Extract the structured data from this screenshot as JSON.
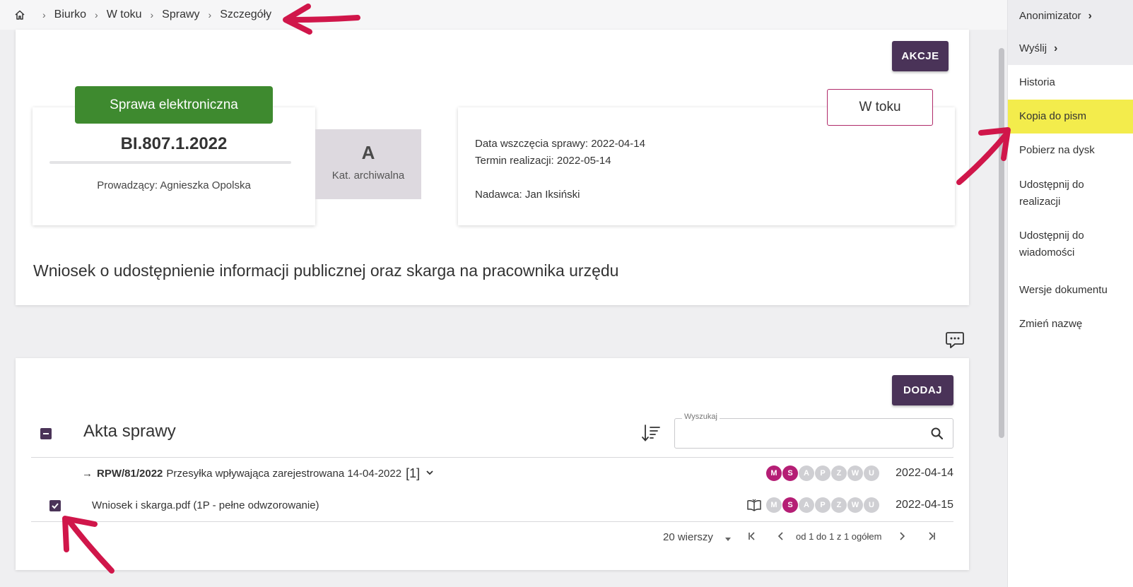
{
  "breadcrumb": {
    "items": [
      "Biurko",
      "W toku",
      "Sprawy",
      "Szczegóły"
    ]
  },
  "case": {
    "actions_button": "AKCJE",
    "type_label": "Sprawa elektroniczna",
    "number": "BI.807.1.2022",
    "lead": "Prowadzący: Agnieszka Opolska",
    "archive_category": "A",
    "archive_label": "Kat. archiwalna",
    "status": "W toku",
    "start_date": "Data wszczęcia sprawy:  2022-04-14",
    "deadline": "Termin realizacji:  2022-05-14",
    "sender": "Nadawca: Jan Iksiński",
    "title": "Wniosek o udostępnienie informacji publicznej oraz skarga na pracownika urzędu"
  },
  "files": {
    "add_button": "DODAJ",
    "section_title": "Akta sprawy",
    "search_label": "Wyszukaj",
    "search_value": "",
    "rows": [
      {
        "arrow": "→",
        "code": "RPW/81/2022",
        "text": "Przesyłka wpływająca zarejestrowana 14-04-2022",
        "count": "[1]",
        "badges": [
          "M",
          "S",
          "A",
          "P",
          "Z",
          "W",
          "U"
        ],
        "active": [
          true,
          true,
          false,
          false,
          false,
          false,
          false
        ],
        "date": "2022-04-14"
      },
      {
        "text": "Wniosek i skarga.pdf (1P - pełne odwzorowanie)",
        "badges": [
          "M",
          "S",
          "A",
          "P",
          "Z",
          "W",
          "U"
        ],
        "active": [
          false,
          true,
          false,
          false,
          false,
          false,
          false
        ],
        "date": "2022-04-15"
      }
    ],
    "pager": {
      "rows_per_page": "20 wierszy",
      "range": "od 1 do 1 z 1 ogółem"
    }
  },
  "side_menu": {
    "items": [
      "Anonimizator",
      "Wyślij",
      "Historia",
      "Kopia do pism",
      "Pobierz na dysk",
      "Udostępnij do",
      "realizacji",
      "Udostępnij do",
      "wiadomości",
      "Wersje dokumentu",
      "Zmień nazwę"
    ]
  },
  "colors": {
    "accent": "#4a3358",
    "case_type": "#3e8a2f",
    "badge_on": "#b51e75",
    "highlight": "#f3ec4c",
    "annotation_arrow": "#d0164a"
  }
}
